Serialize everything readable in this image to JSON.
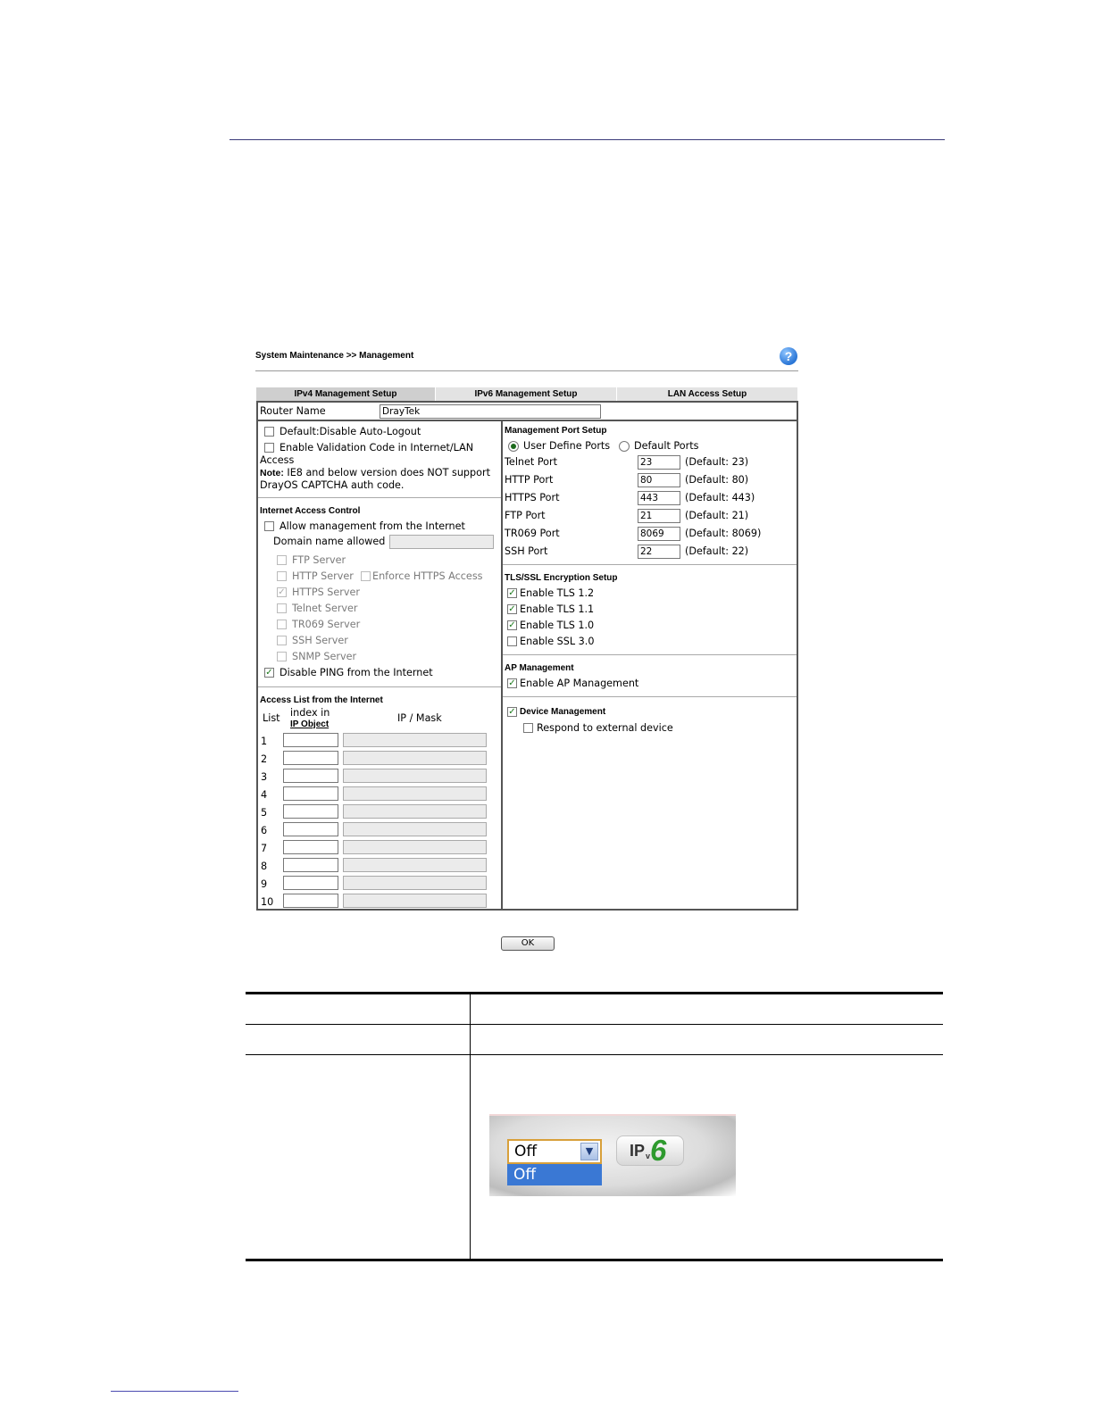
{
  "panel": {
    "title": "System Maintenance >> Management",
    "help_icon": "help-icon"
  },
  "tabs": [
    {
      "label": "IPv4 Management Setup",
      "active": true
    },
    {
      "label": "IPv6 Management Setup",
      "active": false
    },
    {
      "label": "LAN Access Setup",
      "active": false
    }
  ],
  "router": {
    "label": "Router Name",
    "value": "DrayTek"
  },
  "left": {
    "auto_logout": {
      "label": "Default:Disable Auto-Logout",
      "checked": false
    },
    "validation": {
      "label_line1": "Enable Validation Code in Internet/LAN",
      "label_line2": "Access",
      "checked": false
    },
    "note": {
      "bold": "Note:",
      "line1": " IE8 and below version does NOT support",
      "line2": "DrayOS CAPTCHA auth code."
    },
    "iac": {
      "heading": "Internet Access Control",
      "allow": {
        "label": "Allow management from the Internet",
        "checked": false
      },
      "domain_label": "Domain name allowed",
      "domain_value": "",
      "servers": [
        {
          "label": "FTP Server",
          "checked": false
        },
        {
          "label": "HTTP Server",
          "checked": false
        },
        {
          "label": "HTTPS Server",
          "checked": true
        },
        {
          "label": "Telnet Server",
          "checked": false
        },
        {
          "label": "TR069 Server",
          "checked": false
        },
        {
          "label": "SSH Server",
          "checked": false
        },
        {
          "label": "SNMP Server",
          "checked": false
        }
      ],
      "enforce_https": {
        "label": "Enforce HTTPS Access",
        "checked": false
      },
      "disable_ping": {
        "label": "Disable PING from the Internet",
        "checked": true
      }
    },
    "access_list": {
      "heading": "Access List from the Internet",
      "col_list": "List",
      "col_index_line1": "index in",
      "col_index_link": "IP Object",
      "col_ipmask": "IP / Mask",
      "rows": [
        "1",
        "2",
        "3",
        "4",
        "5",
        "6",
        "7",
        "8",
        "9",
        "10"
      ]
    }
  },
  "right": {
    "ports": {
      "heading": "Management Port Setup",
      "radio_user": "User Define Ports",
      "radio_default": "Default Ports",
      "selected": "user",
      "items": [
        {
          "label": "Telnet Port",
          "value": "23",
          "default": "(Default: 23)"
        },
        {
          "label": "HTTP Port",
          "value": "80",
          "default": "(Default: 80)"
        },
        {
          "label": "HTTPS Port",
          "value": "443",
          "default": "(Default: 443)"
        },
        {
          "label": "FTP Port",
          "value": "21",
          "default": "(Default: 21)"
        },
        {
          "label": "TR069 Port",
          "value": "8069",
          "default": "(Default: 8069)"
        },
        {
          "label": "SSH Port",
          "value": "22",
          "default": "(Default: 22)"
        }
      ]
    },
    "tls": {
      "heading": "TLS/SSL Encryption Setup",
      "items": [
        {
          "label": "Enable TLS 1.2",
          "checked": true
        },
        {
          "label": "Enable TLS 1.1",
          "checked": true
        },
        {
          "label": "Enable TLS 1.0",
          "checked": true
        },
        {
          "label": "Enable SSL 3.0",
          "checked": false
        }
      ]
    },
    "ap": {
      "heading": "AP Management",
      "label": "Enable AP Management",
      "checked": true
    },
    "device": {
      "label": "Device Management",
      "checked": true,
      "respond_label": "Respond to external device",
      "respond_checked": false
    }
  },
  "ok_label": "OK",
  "inset": {
    "select_value": "Off",
    "option_highlight": "Off",
    "badge_ip": "IP",
    "badge_v": "v",
    "badge_six": "6"
  }
}
